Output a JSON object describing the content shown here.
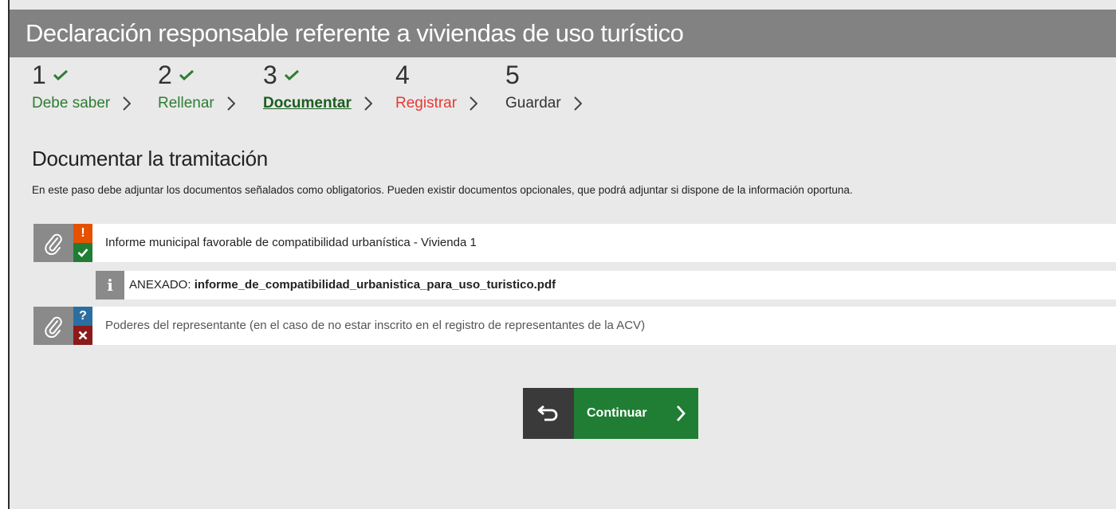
{
  "header": {
    "title": "Declaración responsable referente a viviendas de uso turístico"
  },
  "steps": [
    {
      "number": "1",
      "label": "Debe saber",
      "done": true,
      "state": "done"
    },
    {
      "number": "2",
      "label": "Rellenar",
      "done": true,
      "state": "done"
    },
    {
      "number": "3",
      "label": "Documentar",
      "done": true,
      "state": "current"
    },
    {
      "number": "4",
      "label": "Registrar",
      "done": false,
      "state": "error"
    },
    {
      "number": "5",
      "label": "Guardar",
      "done": false,
      "state": "pending"
    }
  ],
  "section": {
    "title": "Documentar la tramitación",
    "description": "En este paso debe adjuntar los documentos señalados como obligatorios. Pueden existir documentos opcionales, que podrá adjuntar si dispone de la información oportuna."
  },
  "documents": [
    {
      "title": "Informe municipal favorable de compatibilidad urbanística - Vivienda 1",
      "status_top": "!",
      "status_bottom": "check",
      "attachment_prefix": "ANEXADO: ",
      "attachment_file": "informe_de_compatibilidad_urbanistica_para_uso_turistico.pdf",
      "info_icon": "i"
    },
    {
      "title": "Poderes del representante (en el caso de no estar inscrito en el registro de representantes de la ACV)",
      "status_top": "?",
      "status_bottom": "cross"
    }
  ],
  "actions": {
    "back_icon": "return-arrow-icon",
    "continue_label": "Continuar"
  },
  "colors": {
    "header_bg": "#828282",
    "done_green": "#2e7d32",
    "error_red": "#e53935",
    "warning_orange": "#e65100",
    "question_blue": "#2a6fa0",
    "cross_red": "#8b1a1a",
    "continue_green": "#1f7e34",
    "back_dark": "#3a3a3a"
  }
}
